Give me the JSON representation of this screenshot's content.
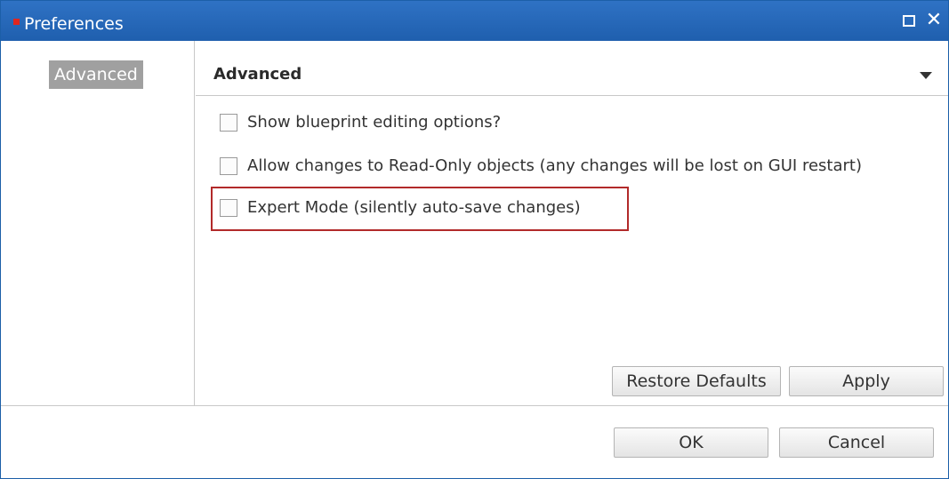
{
  "window": {
    "title": "Preferences",
    "maximize_icon": "maximize-icon",
    "close_icon": "close-icon",
    "close_glyph": "✕"
  },
  "sidebar": {
    "items": [
      {
        "label": "Advanced",
        "selected": true
      }
    ]
  },
  "section": {
    "title": "Advanced",
    "toggle_icon": "chevron-down-icon"
  },
  "options": [
    {
      "label": "Show blueprint editing options?",
      "checked": false
    },
    {
      "label": "Allow changes to Read-Only objects (any changes will be lost on GUI restart)",
      "checked": false
    },
    {
      "label": "Expert Mode (silently auto-save changes)",
      "checked": false,
      "highlighted": true
    }
  ],
  "section_buttons": {
    "restore_defaults": "Restore Defaults",
    "apply": "Apply"
  },
  "dialog_buttons": {
    "ok": "OK",
    "cancel": "Cancel"
  },
  "colors": {
    "titlebar": "#1f5fae",
    "highlight_border": "#b22a2a",
    "selected_item_bg": "#a0a0a0"
  }
}
